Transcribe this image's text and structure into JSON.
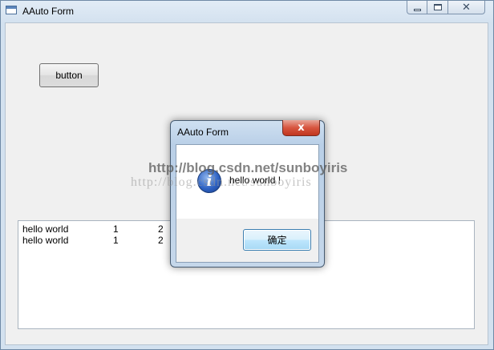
{
  "main_window": {
    "title": "AAuto Form",
    "button_label": "button",
    "output_lines": [
      {
        "text": "hello world",
        "col2": "1",
        "col3": "2"
      },
      {
        "text": "hello world",
        "col2": "1",
        "col3": "2"
      }
    ]
  },
  "dialog": {
    "title": "AAuto Form",
    "message": "hello world !",
    "ok_label": "确定",
    "close_glyph": "x",
    "icon": "info-icon",
    "icon_glyph": "i"
  },
  "watermark": {
    "text_bold": "http://blog.csdn.net/sunboyiris",
    "text_light": "http://blog.csdn.net/sunboyiris"
  },
  "colors": {
    "dialog_close": "#c7432b",
    "ok_button": "#bee6fd",
    "info_icon": "#2f63c4"
  }
}
